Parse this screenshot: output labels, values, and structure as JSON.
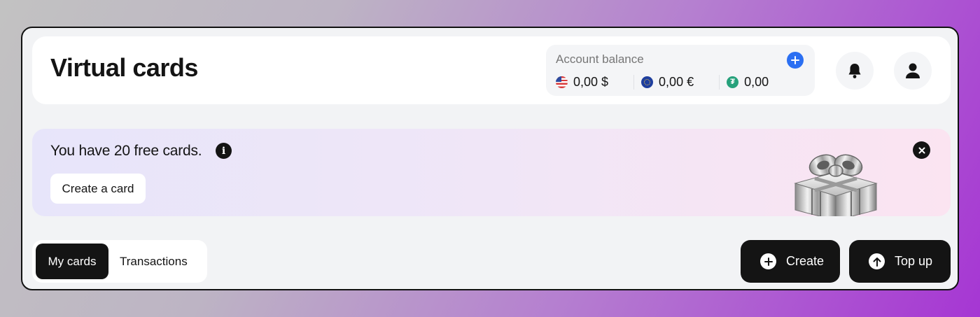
{
  "header": {
    "title": "Virtual cards",
    "balance": {
      "label": "Account balance",
      "add_icon": "plus-icon",
      "currencies": [
        {
          "icon": "us-flag-icon",
          "value": "0,00 $"
        },
        {
          "icon": "eu-flag-icon",
          "value": "0,00 €"
        },
        {
          "icon": "usdt-icon",
          "value": "0,00"
        }
      ]
    },
    "notifications_icon": "bell-icon",
    "profile_icon": "user-icon"
  },
  "banner": {
    "text": "You have 20 free cards.",
    "info_icon_glyph": "i",
    "button_label": "Create a card",
    "image": "gift-box-image",
    "close_icon": "close-icon"
  },
  "tabs": [
    {
      "label": "My cards",
      "active": true
    },
    {
      "label": "Transactions",
      "active": false
    }
  ],
  "actions": {
    "create_label": "Create",
    "topup_label": "Top up"
  },
  "colors": {
    "accent_blue": "#2b6ff2",
    "dark": "#141414",
    "usdt_green": "#26a17b"
  }
}
